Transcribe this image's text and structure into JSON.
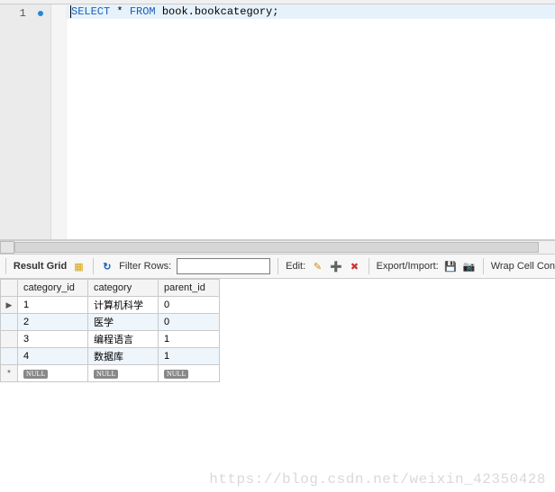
{
  "editor": {
    "line_number": "1",
    "sql_kw1": "SELECT",
    "sql_mid": " * ",
    "sql_kw2": "FROM",
    "sql_rest": " book.bookcategory;"
  },
  "toolbar": {
    "result_grid_label": "Result Grid",
    "filter_label": "Filter Rows:",
    "filter_value": "",
    "edit_label": "Edit:",
    "export_label": "Export/Import:",
    "wrap_label": "Wrap Cell Con"
  },
  "icons": {
    "grid": "▦",
    "refresh": "↻",
    "edit_pencil": "✎",
    "edit_add": "➕",
    "edit_del": "✖",
    "export1": "💾",
    "export2": "📷"
  },
  "columns": {
    "c1": "category_id",
    "c2": "category",
    "c3": "parent_id"
  },
  "rows": [
    {
      "c1": "1",
      "c2": "计算机科学",
      "c3": "0"
    },
    {
      "c1": "2",
      "c2": "医学",
      "c3": "0"
    },
    {
      "c1": "3",
      "c2": "编程语言",
      "c3": "1"
    },
    {
      "c1": "4",
      "c2": "数据库",
      "c3": "1"
    }
  ],
  "null_label": "NULL",
  "watermark": "https://blog.csdn.net/weixin_42350428"
}
